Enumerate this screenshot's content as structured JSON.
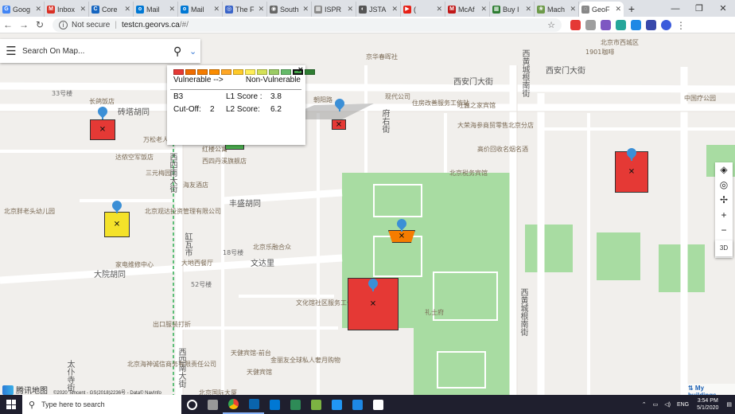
{
  "tabs": [
    {
      "label": "Goog",
      "fav_color": "#4285f4",
      "fav_glyph": "G"
    },
    {
      "label": "Inbox",
      "fav_color": "#d93025",
      "fav_glyph": "M"
    },
    {
      "label": "Core",
      "fav_color": "#1565c0",
      "fav_glyph": "C"
    },
    {
      "label": "Mail",
      "fav_color": "#0078d4",
      "fav_glyph": "o"
    },
    {
      "label": "Mail",
      "fav_color": "#0078d4",
      "fav_glyph": "o"
    },
    {
      "label": "The F",
      "fav_color": "#3a64c8",
      "fav_glyph": "◎"
    },
    {
      "label": "South",
      "fav_color": "#666666",
      "fav_glyph": "◉"
    },
    {
      "label": "ISPR",
      "fav_color": "#8a8a8a",
      "fav_glyph": "▦"
    },
    {
      "label": "JSTA",
      "fav_color": "#555555",
      "fav_glyph": "◐"
    },
    {
      "label": "(",
      "fav_color": "#e62117",
      "fav_glyph": "▶"
    },
    {
      "label": "McAf",
      "fav_color": "#c01818",
      "fav_glyph": "M"
    },
    {
      "label": "Buy I",
      "fav_color": "#2e7d32",
      "fav_glyph": "▦"
    },
    {
      "label": "Mach",
      "fav_color": "#6d9a4a",
      "fav_glyph": "❀"
    },
    {
      "label": "GeoF",
      "fav_color": "#888888",
      "fav_glyph": "◌",
      "active": true
    }
  ],
  "window_controls": {
    "minimize": "—",
    "maximize": "❐",
    "close": "✕"
  },
  "address_bar": {
    "security": "Not secure",
    "host": "testcn.georvs.ca",
    "path": "/#/"
  },
  "extension_colors": [
    "#e53935",
    "#9e9e9e",
    "#7e57c2",
    "#26a69a",
    "#1e88e5",
    "#3949ab"
  ],
  "search": {
    "placeholder": "Search On Map..."
  },
  "popup": {
    "scale_colors": [
      "#e53935",
      "#ef6c00",
      "#f57c00",
      "#fb8c00",
      "#ffa726",
      "#ffca28",
      "#ffee58",
      "#d4e157",
      "#9ccc65",
      "#66bb6a",
      "#43a047",
      "#2e7d32"
    ],
    "legend_left": "Vulnerable -->",
    "legend_right": "Non-Vulnerable",
    "building_id": "B3",
    "l1_label": "L1 Score :",
    "l1_value": "3.8",
    "cutoff_label": "Cut-Off:",
    "cutoff_value": "2",
    "l2_label": "L2 Score:",
    "l2_value": "6.2",
    "close": "×"
  },
  "parcels": [
    {
      "name": "building-b1",
      "color": "#e53935",
      "score": "vulnerable"
    },
    {
      "name": "building-b2",
      "color": "#f4e22a",
      "score": "moderate"
    },
    {
      "name": "building-b3",
      "color": "#4caf50",
      "score": "non-vulnerable"
    },
    {
      "name": "building-b4",
      "color": "#e53935",
      "score": "vulnerable"
    },
    {
      "name": "building-b5",
      "color": "#f57c00",
      "score": "moderate"
    },
    {
      "name": "building-b6",
      "color": "#e53935",
      "score": "vulnerable"
    },
    {
      "name": "building-b7",
      "color": "#e53935",
      "score": "vulnerable"
    }
  ],
  "map_labels": {
    "roads": [
      "砖塔胡同",
      "大院胡同",
      "西安门大街",
      "西安门大街",
      "西四南大街",
      "西四南大街",
      "西黄城根南街",
      "西黄城根南街",
      "缸瓦市",
      "丰盛胡同",
      "文达里",
      "太仆寺街",
      "府右街"
    ],
    "pois": [
      "长鸽饭店",
      "万松老人塔",
      "达侬空军饭店",
      "三元梅园",
      "海友酒店",
      "红楼公寓",
      "西四丹溪旗舰店",
      "北京胖老头幼儿园",
      "北京乐融合众",
      "北京观达投资管理有限公司",
      "文化馆社区服务工作室",
      "大地西餐厅",
      "家电维修中心",
      "北京国际大厦",
      "出口服装打折",
      "北京海神诚信商务有限责任公司",
      "天健宾馆-前台",
      "金丽友全球私人奢月购物",
      "天健宾馆",
      "礼士府",
      "北京税务宾馆",
      "高价回收名烟名酒",
      "大荣海参商贸零售北京分店",
      "旺鑫之家宾馆",
      "住房改善服务工作站",
      "现代公司",
      "京华春晖社"
    ],
    "misc": [
      "33号楼",
      "18号楼",
      "52号楼",
      "1901咖啡",
      "中国疗公园",
      "朝阳路",
      "北京市西城区"
    ]
  },
  "map_controls": {
    "layers": "layers-icon",
    "locate": "locate-icon",
    "compass": "compass-icon",
    "zoom_in": "+",
    "zoom_out": "−",
    "view_3d": "3D"
  },
  "branding": {
    "brand": "腾讯地图",
    "copyright": "©2020 Tencent - GS(2018)2236号 - Data© NavInfo",
    "my_buildings": "⇅ My buildings"
  },
  "taskbar": {
    "search_placeholder": "Type here to search",
    "pinned_colors": [
      "#ffffff",
      "#999999",
      "#f7b500",
      "#0a64ad",
      "#0078d4",
      "#2e8b57",
      "#7cb342",
      "#2196f3",
      "#1e88e5",
      "#ffffff"
    ],
    "lang": "ENG",
    "time": "3:54 PM",
    "date": "5/1/2020"
  }
}
